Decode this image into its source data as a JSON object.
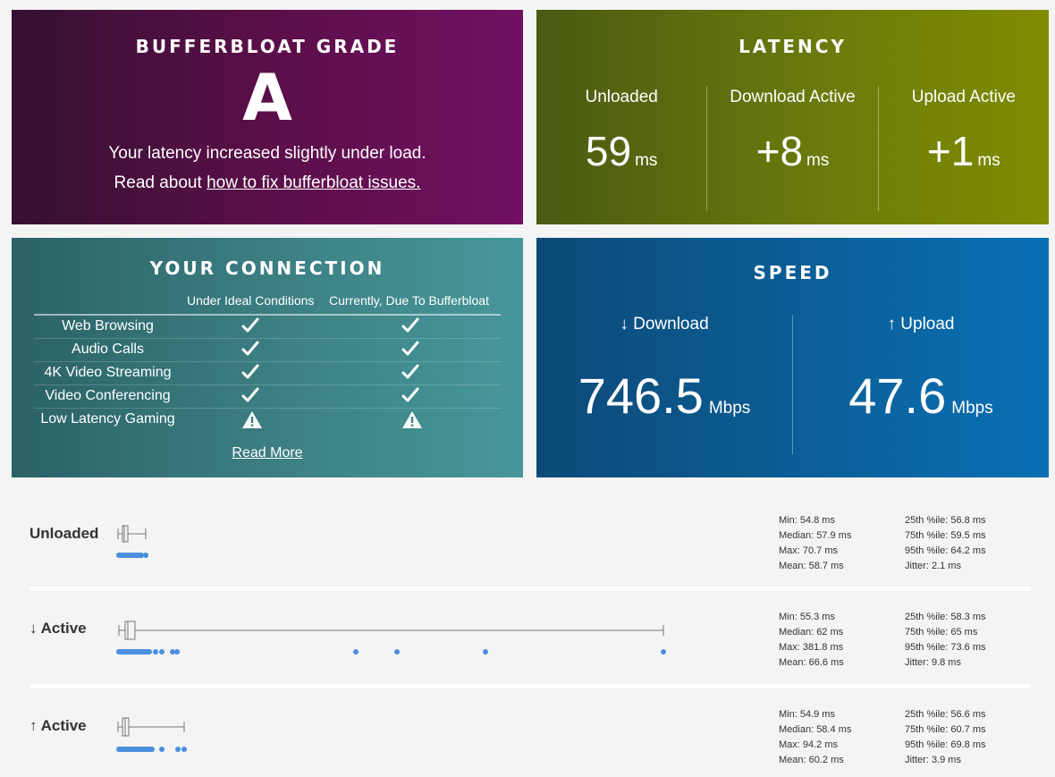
{
  "grade": {
    "title": "BUFFERBLOAT GRADE",
    "letter": "A",
    "line1": "Your latency increased slightly under load.",
    "line2_prefix": "Read about ",
    "line2_link": "how to fix bufferbloat issues."
  },
  "latency": {
    "title": "LATENCY",
    "columns": [
      {
        "label": "Unloaded",
        "value": "59",
        "unit": "ms"
      },
      {
        "label": "Download Active",
        "value": "+8",
        "unit": "ms"
      },
      {
        "label": "Upload Active",
        "value": "+1",
        "unit": "ms"
      }
    ]
  },
  "connection": {
    "title": "YOUR CONNECTION",
    "col1_header": "Under Ideal Conditions",
    "col2_header": "Currently, Due To Bufferbloat",
    "rows": [
      {
        "name": "Web Browsing",
        "ideal": "check-icon",
        "current": "check-icon"
      },
      {
        "name": "Audio Calls",
        "ideal": "check-icon",
        "current": "check-icon"
      },
      {
        "name": "4K Video Streaming",
        "ideal": "check-icon",
        "current": "check-icon"
      },
      {
        "name": "Video Conferencing",
        "ideal": "check-icon",
        "current": "check-icon"
      },
      {
        "name": "Low Latency Gaming",
        "ideal": "warning-icon",
        "current": "warning-icon"
      }
    ],
    "read_more": "Read More"
  },
  "speed": {
    "title": "SPEED",
    "download_label": "↓ Download",
    "download_value": "746.5",
    "download_unit": "Mbps",
    "upload_label": "↑ Upload",
    "upload_value": "47.6",
    "upload_unit": "Mbps"
  },
  "latency_rows": [
    {
      "label": "Unloaded",
      "stats_left": [
        "Min: 54.8 ms",
        "Median: 57.9 ms",
        "Max: 70.7 ms",
        "Mean: 58.7 ms"
      ],
      "stats_right": [
        "25th %ile: 56.8 ms",
        "75th %ile: 59.5 ms",
        "95th %ile: 64.2 ms",
        "Jitter: 2.1 ms"
      ]
    },
    {
      "label": "↓ Active",
      "stats_left": [
        "Min: 55.3 ms",
        "Median: 62 ms",
        "Max: 381.8 ms",
        "Mean: 66.6 ms"
      ],
      "stats_right": [
        "25th %ile: 58.3 ms",
        "75th %ile: 65 ms",
        "95th %ile: 73.6 ms",
        "Jitter: 9.8 ms"
      ]
    },
    {
      "label": "↑ Active",
      "stats_left": [
        "Min: 54.9 ms",
        "Median: 58.4 ms",
        "Max: 94.2 ms",
        "Mean: 60.2 ms"
      ],
      "stats_right": [
        "25th %ile: 56.6 ms",
        "75th %ile: 60.7 ms",
        "95th %ile: 69.8 ms",
        "Jitter: 3.9 ms"
      ]
    }
  ],
  "colors": {
    "grade_bg": "#5a0f48",
    "latency_bg": "#6b7a0c",
    "connection_bg": "#3d8185",
    "speed_bg": "#0b5f98",
    "dot_color": "#4a8fdd"
  }
}
